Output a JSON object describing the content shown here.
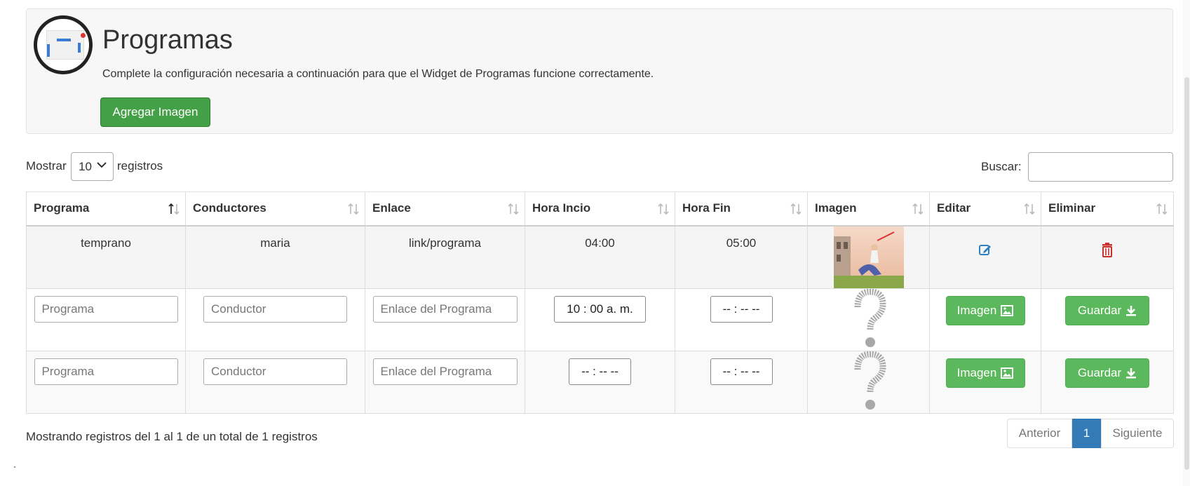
{
  "header": {
    "title": "Programas",
    "subtitle": "Complete la configuración necesaria a continuación para que el Widget de Programas funcione correctamente.",
    "add_button": "Agregar Imagen"
  },
  "length": {
    "label_before": "Mostrar",
    "value": "10",
    "label_after": "registros"
  },
  "search": {
    "label": "Buscar:",
    "value": ""
  },
  "table": {
    "columns": [
      "Programa",
      "Conductores",
      "Enlace",
      "Hora Incio",
      "Hora Fin",
      "Imagen",
      "Editar",
      "Eliminar"
    ],
    "row": {
      "programa": "temprano",
      "conductor": "maria",
      "enlace": "link/programa",
      "inicio": "04:00",
      "fin": "05:00"
    },
    "new_rows": [
      {
        "programa_placeholder": "Programa",
        "conductor_placeholder": "Conductor",
        "enlace_placeholder": "Enlace del Programa",
        "inicio": "10 : 00   a. m.",
        "fin": "-- : --   --",
        "image_button": "Imagen",
        "save_button": "Guardar"
      },
      {
        "programa_placeholder": "Programa",
        "conductor_placeholder": "Conductor",
        "enlace_placeholder": "Enlace del Programa",
        "inicio": "-- : --   --",
        "fin": "-- : --   --",
        "image_button": "Imagen",
        "save_button": "Guardar"
      }
    ]
  },
  "footer": {
    "info": "Mostrando registros del 1 al 1 de un total de 1 registros",
    "prev": "Anterior",
    "current_page": "1",
    "next": "Siguiente"
  },
  "colors": {
    "primary_green": "#43a047",
    "button_green": "#5cb85c",
    "page_blue": "#337ab7",
    "edit_blue": "#2f7fc1",
    "delete_red": "#c9302c"
  },
  "icons": [
    "logo-icon",
    "chevron-down-icon",
    "sort-icon",
    "edit-icon",
    "trash-icon",
    "image-icon",
    "download-icon",
    "question-mark-icon"
  ]
}
